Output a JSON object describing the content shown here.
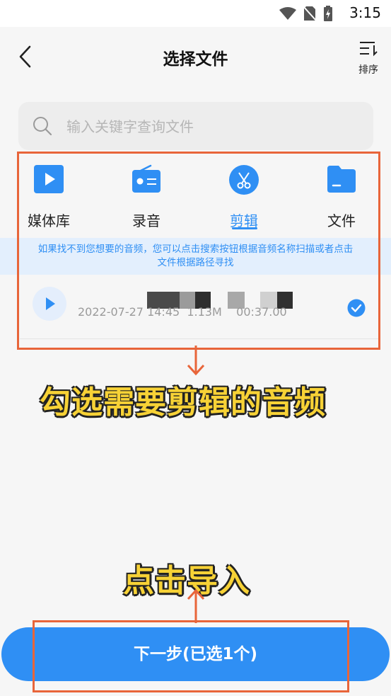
{
  "status_bar": {
    "time": "3:15"
  },
  "header": {
    "title": "选择文件",
    "sort_label": "排序"
  },
  "search": {
    "placeholder": "输入关键字查询文件",
    "value": ""
  },
  "tabs": [
    {
      "label": "媒体库",
      "icon": "play-square-icon"
    },
    {
      "label": "录音",
      "icon": "radio-icon"
    },
    {
      "label": "剪辑",
      "icon": "scissors-icon",
      "active": true
    },
    {
      "label": "文件",
      "icon": "folder-icon"
    }
  ],
  "hint": {
    "text": "如果找不到您想要的音频，您可以点击搜索按钮根据音频名称扫描或者点击文件根据路径寻找"
  },
  "audio_item": {
    "date": "2022-07-27 14:45",
    "size": "1.13M",
    "duration": "00:37.00",
    "selected": true
  },
  "annotations": {
    "select_hint": "勾选需要剪辑的音频",
    "import_hint": "点击导入"
  },
  "footer": {
    "next_label": "下一步(已选1个)"
  },
  "colors": {
    "accent": "#2f8ff4",
    "annotation_border": "#e8653a",
    "annotation_text": "#f7d236"
  }
}
